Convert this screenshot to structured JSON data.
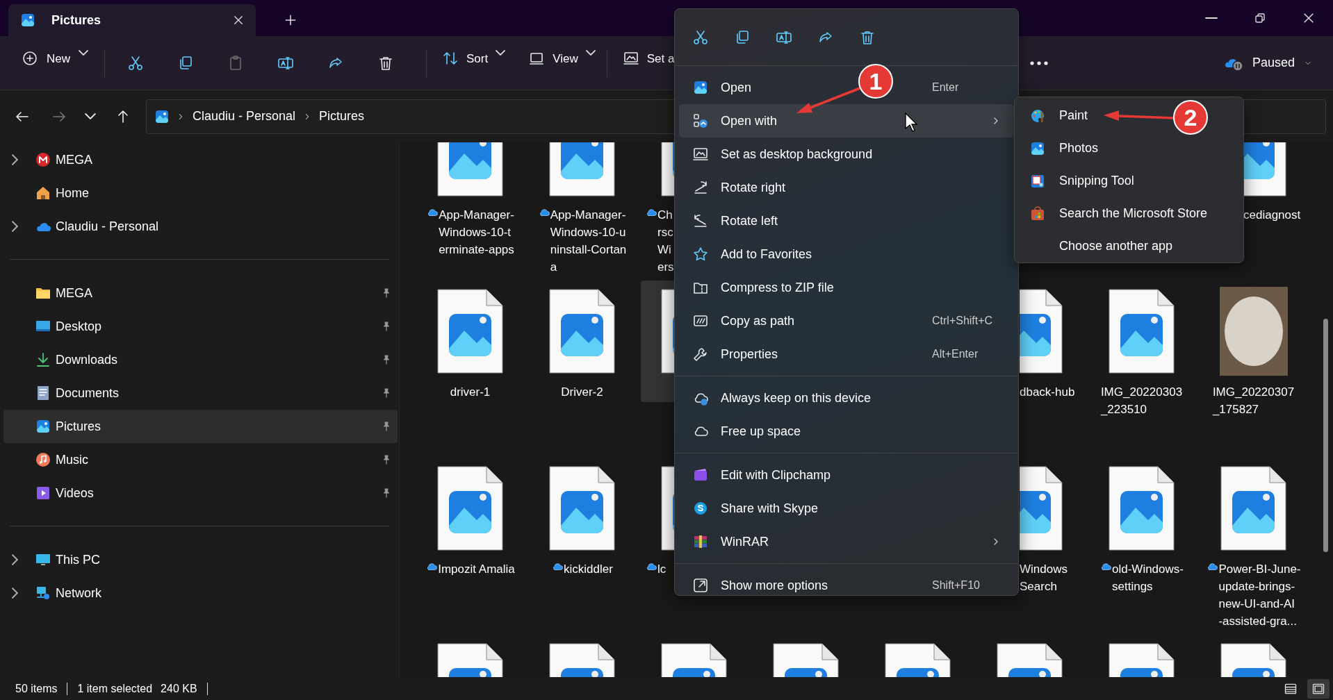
{
  "window": {
    "tab": {
      "title": "Pictures"
    }
  },
  "toolbar": {
    "items": [
      {
        "kind": "new",
        "label": "New",
        "dropdown": true,
        "disabled": false
      },
      {
        "kind": "separator"
      },
      {
        "kind": "cut",
        "disabled": false
      },
      {
        "kind": "copy",
        "disabled": false
      },
      {
        "kind": "paste",
        "disabled": true
      },
      {
        "kind": "rename",
        "disabled": false
      },
      {
        "kind": "share",
        "disabled": false
      },
      {
        "kind": "delete",
        "disabled": false
      },
      {
        "kind": "separator"
      },
      {
        "kind": "sort",
        "label": "Sort",
        "dropdown": true,
        "disabled": false
      },
      {
        "kind": "view",
        "label": "View",
        "dropdown": true,
        "disabled": false
      },
      {
        "kind": "separator"
      },
      {
        "kind": "setbg",
        "label": "Set a",
        "dropdown": false,
        "disabled": false
      }
    ],
    "sync": {
      "label": "Paused"
    }
  },
  "nav": [
    {
      "kind": "back",
      "disabled": false
    },
    {
      "kind": "forward",
      "disabled": true
    },
    {
      "kind": "recent",
      "disabled": false
    },
    {
      "kind": "up",
      "disabled": false
    }
  ],
  "breadcrumb": [
    "Claudiu - Personal",
    "Pictures"
  ],
  "sidebar": {
    "groups": [
      [
        {
          "kind": "mega",
          "label": "MEGA",
          "expandable": true,
          "pinned": false,
          "selected": false
        },
        {
          "kind": "home",
          "label": "Home",
          "expandable": false,
          "pinned": false,
          "selected": false
        },
        {
          "kind": "onedrive",
          "label": "Claudiu - Personal",
          "expandable": true,
          "pinned": false,
          "selected": false
        }
      ],
      [
        {
          "kind": "folder",
          "label": "MEGA",
          "expandable": false,
          "pinned": true,
          "selected": false
        },
        {
          "kind": "desktop",
          "label": "Desktop",
          "expandable": false,
          "pinned": true,
          "selected": false
        },
        {
          "kind": "downloads",
          "label": "Downloads",
          "expandable": false,
          "pinned": true,
          "selected": false
        },
        {
          "kind": "documents",
          "label": "Documents",
          "expandable": false,
          "pinned": true,
          "selected": false
        },
        {
          "kind": "pictures",
          "label": "Pictures",
          "expandable": false,
          "pinned": true,
          "selected": true
        },
        {
          "kind": "music",
          "label": "Music",
          "expandable": false,
          "pinned": true,
          "selected": false
        },
        {
          "kind": "videos",
          "label": "Videos",
          "expandable": false,
          "pinned": true,
          "selected": false
        }
      ],
      [
        {
          "kind": "pc",
          "label": "This PC",
          "expandable": true,
          "pinned": false,
          "selected": false
        },
        {
          "kind": "network",
          "label": "Network",
          "expandable": true,
          "pinned": false,
          "selected": false
        }
      ]
    ]
  },
  "files": {
    "rows": [
      [
        {
          "kind": "file",
          "lines": [
            "App-Manager-",
            "Windows-10-t",
            "erminate-apps"
          ],
          "cloud": true,
          "selected": false
        },
        {
          "kind": "file",
          "lines": [
            "App-Manager-",
            "Windows-10-u",
            "ninstall-Cortan",
            "a"
          ],
          "cloud": true,
          "selected": false
        },
        {
          "kind": "clip-right",
          "lines": [
            "Ch",
            "rsc",
            "Wi",
            "ers"
          ],
          "cloud": true,
          "selected": false
        },
        {
          "kind": "hidden"
        },
        {
          "kind": "hidden"
        },
        {
          "kind": "hidden"
        },
        {
          "kind": "hidden"
        },
        {
          "kind": "clip-left",
          "lines": [
            "cediagnost"
          ],
          "cloud": false,
          "selected": false
        }
      ],
      [
        {
          "kind": "file",
          "lines": [
            "driver-1"
          ],
          "cloud": false,
          "selected": false
        },
        {
          "kind": "file",
          "lines": [
            "Driver-2"
          ],
          "cloud": false,
          "selected": false
        },
        {
          "kind": "clip-right",
          "cloud": false,
          "selected": true
        },
        {
          "kind": "hidden"
        },
        {
          "kind": "hidden"
        },
        {
          "kind": "clip-left",
          "lines": [
            "dback-hub"
          ],
          "cloud": false,
          "selected": false
        },
        {
          "kind": "file",
          "lines": [
            "IMG_20220303",
            "_223510"
          ],
          "cloud": false,
          "selected": false
        },
        {
          "kind": "photo",
          "lines": [
            "IMG_20220307",
            "_175827"
          ],
          "cloud": false,
          "selected": false
        }
      ],
      [
        {
          "kind": "file",
          "lines": [
            "Impozit Amalia"
          ],
          "cloud": true,
          "selected": false
        },
        {
          "kind": "file",
          "lines": [
            "kickiddler"
          ],
          "cloud": true,
          "selected": false
        },
        {
          "kind": "clip-right",
          "lines": [
            "lc"
          ],
          "cloud": true,
          "selected": false
        },
        {
          "kind": "hidden"
        },
        {
          "kind": "hidden"
        },
        {
          "kind": "clip-left",
          "lines": [
            "Windows",
            "Search"
          ],
          "cloud": false,
          "selected": false
        },
        {
          "kind": "file",
          "lines": [
            "old-Windows-",
            "settings"
          ],
          "cloud": true,
          "selected": false
        },
        {
          "kind": "file",
          "lines": [
            "Power-BI-June-",
            "update-brings-",
            "new-UI-and-AI",
            "-assisted-gra..."
          ],
          "cloud": true,
          "selected": false
        }
      ],
      [
        {
          "kind": "file",
          "cloud": false,
          "selected": false
        },
        {
          "kind": "file",
          "cloud": false,
          "selected": false
        },
        {
          "kind": "file",
          "cloud": false,
          "selected": false
        },
        {
          "kind": "file",
          "cloud": false,
          "selected": false
        },
        {
          "kind": "file",
          "cloud": false,
          "selected": false
        },
        {
          "kind": "file",
          "cloud": false,
          "selected": false
        },
        {
          "kind": "file",
          "cloud": false,
          "selected": false
        },
        {
          "kind": "file",
          "cloud": false,
          "selected": false
        }
      ]
    ]
  },
  "status_bar": {
    "count": "50 items",
    "selection": "1 item selected",
    "size": "240 KB",
    "views": [
      {
        "kind": "details",
        "selected": false
      },
      {
        "kind": "tiles",
        "selected": true
      }
    ]
  },
  "context_menu": {
    "actions": [
      {
        "kind": "cut"
      },
      {
        "kind": "copy"
      },
      {
        "kind": "rename"
      },
      {
        "kind": "share"
      },
      {
        "kind": "delete"
      }
    ],
    "groups": [
      [
        {
          "kind": "open",
          "label": "Open",
          "shortcut": "Enter",
          "submenu": false,
          "selected": false
        },
        {
          "kind": "openwith",
          "label": "Open with",
          "submenu": true,
          "selected": true
        },
        {
          "kind": "setbg",
          "label": "Set as desktop background",
          "submenu": false,
          "selected": false
        },
        {
          "kind": "rotateright",
          "label": "Rotate right",
          "submenu": false,
          "selected": false
        },
        {
          "kind": "rotateleft",
          "label": "Rotate left",
          "submenu": false,
          "selected": false
        },
        {
          "kind": "favorites",
          "label": "Add to Favorites",
          "submenu": false,
          "selected": false
        },
        {
          "kind": "zip",
          "label": "Compress to ZIP file",
          "submenu": false,
          "selected": false
        },
        {
          "kind": "copypath",
          "label": "Copy as path",
          "shortcut": "Ctrl+Shift+C",
          "submenu": false,
          "selected": false
        },
        {
          "kind": "properties",
          "label": "Properties",
          "shortcut": "Alt+Enter",
          "submenu": false,
          "selected": false
        }
      ],
      [
        {
          "kind": "keep",
          "label": "Always keep on this device",
          "submenu": false,
          "selected": false
        },
        {
          "kind": "free",
          "label": "Free up space",
          "submenu": false,
          "selected": false
        }
      ],
      [
        {
          "kind": "clipchamp",
          "label": "Edit with Clipchamp",
          "submenu": false,
          "selected": false
        },
        {
          "kind": "skype",
          "label": "Share with Skype",
          "submenu": false,
          "selected": false
        },
        {
          "kind": "winrar",
          "label": "WinRAR",
          "submenu": true,
          "selected": false
        }
      ],
      [
        {
          "kind": "showmore",
          "label": "Show more options",
          "shortcut": "Shift+F10",
          "submenu": false,
          "selected": false
        }
      ]
    ]
  },
  "open_with_menu": {
    "items": [
      {
        "kind": "paint",
        "label": "Paint",
        "selected": false
      },
      {
        "kind": "photos",
        "label": "Photos",
        "selected": false
      },
      {
        "kind": "snipping",
        "label": "Snipping Tool",
        "selected": false
      },
      {
        "kind": "store",
        "label": "Search the Microsoft Store",
        "selected": false
      },
      {
        "kind": "none",
        "label": "Choose another app",
        "selected": false
      }
    ]
  },
  "annotations": [
    {
      "number": "1"
    },
    {
      "number": "2"
    }
  ]
}
